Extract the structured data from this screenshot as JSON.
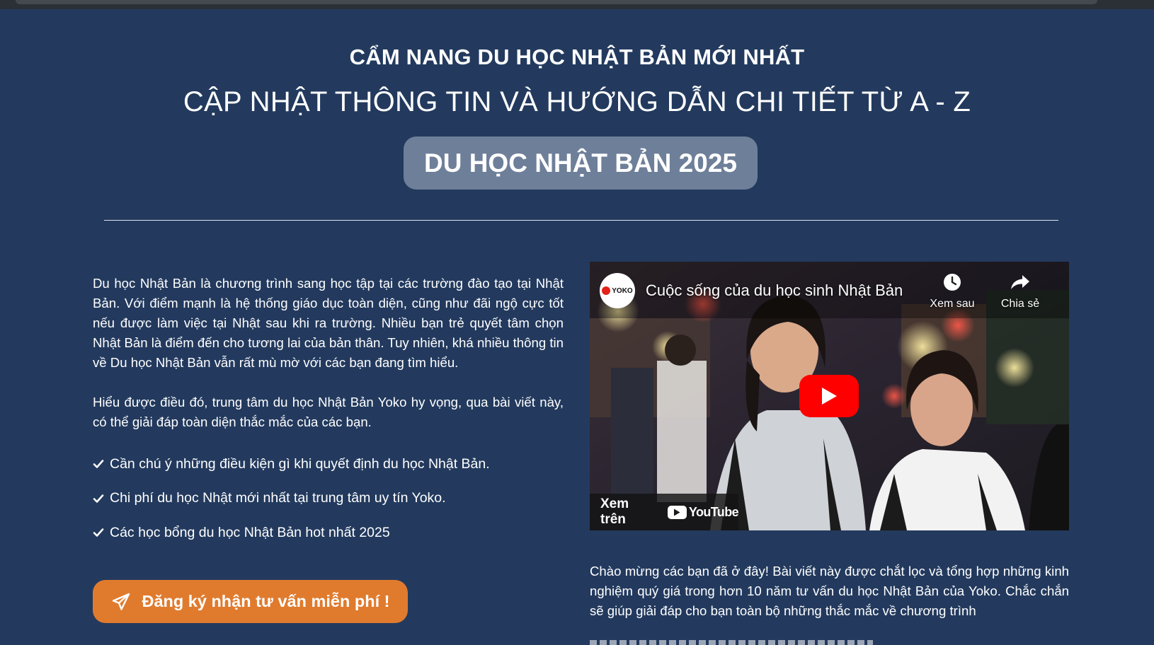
{
  "header": {
    "kicker": "CẨM NANG DU HỌC NHẬT BẢN MỚI NHẤT",
    "headline": "CẬP NHẬT THÔNG TIN VÀ HƯỚNG DẪN CHI TIẾT TỪ A - Z",
    "pill_label": "DU HỌC NHẬT BẢN 2025"
  },
  "intro": {
    "paragraph_1": "Du học Nhật Bản là chương trình sang học tập tại các trường đào tạo tại Nhật Bản. Với điểm mạnh là hệ thống giáo dục toàn diện, cũng như đãi ngộ cực tốt nếu được làm việc tại Nhật sau khi ra trường. Nhiều bạn trẻ quyết tâm chọn Nhật Bản là điểm đến cho tương lai của bản thân. Tuy nhiên, khá nhiều thông tin về Du học Nhật Bản vẫn rất mù mờ với các bạn đang tìm hiểu.",
    "paragraph_2": "Hiểu được điều đó, trung tâm du học Nhật Bản Yoko hy vọng, qua bài viết này, có thể giải đáp toàn diện thắc mắc của các bạn."
  },
  "checklist": [
    "Cần chú ý những điều kiện gì khi quyết định du học Nhật Bản.",
    "Chi phí du học Nhật mới nhất tại trung tâm uy tín Yoko.",
    "Các học bổng du học Nhật Bản hot nhất 2025"
  ],
  "cta": {
    "label": "Đăng ký nhận tư vấn miễn phí !"
  },
  "video": {
    "channel_logo_text": "YOKO",
    "title": "Cuộc sống của du học sinh Nhật Bản",
    "watch_later": "Xem sau",
    "share": "Chia sẻ",
    "watch_on": "Xem trên",
    "youtube": "YouTube",
    "accent_color": "#ff0000"
  },
  "welcome": {
    "text": "Chào mừng các bạn đã ở đây! Bài viết này được chắt lọc và tổng hợp những kinh nghiệm quý giá trong hơn 10 năm tư vấn du học Nhật Bản của Yoko. Chắc chắn sẽ giúp giải đáp cho bạn toàn bộ những thắc mắc về chương trình"
  },
  "colors": {
    "background": "#233a5e",
    "pill": "#6e7f99",
    "cta": "#e07b2e"
  },
  "icons": {
    "check": "check-icon",
    "cta": "paper-plane-icon",
    "watch_later": "clock-icon",
    "share": "share-arrow-icon",
    "play": "play-icon"
  }
}
